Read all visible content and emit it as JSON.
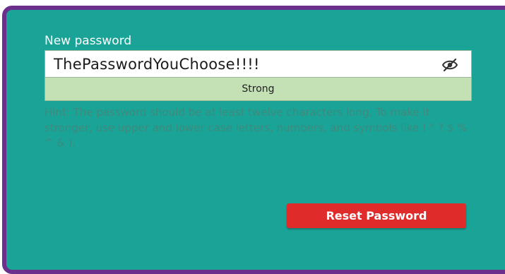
{
  "form": {
    "label": "New password",
    "password_value": "ThePasswordYouChoose!!!!",
    "toggle_icon": "eye-slash-icon",
    "strength": "Strong",
    "hint": "Hint: The password should be at least twelve characters long. To make it stronger, use upper and lower case letters, numbers, and symbols like ! \" ? $ % ^ & ).",
    "submit_label": "Reset Password"
  },
  "colors": {
    "panel_background": "#1aa397",
    "panel_border": "#6b2f8c",
    "strength_background": "#c3e1b4",
    "hint_text": "#3f8a7d",
    "button_background": "#e02b2b"
  }
}
